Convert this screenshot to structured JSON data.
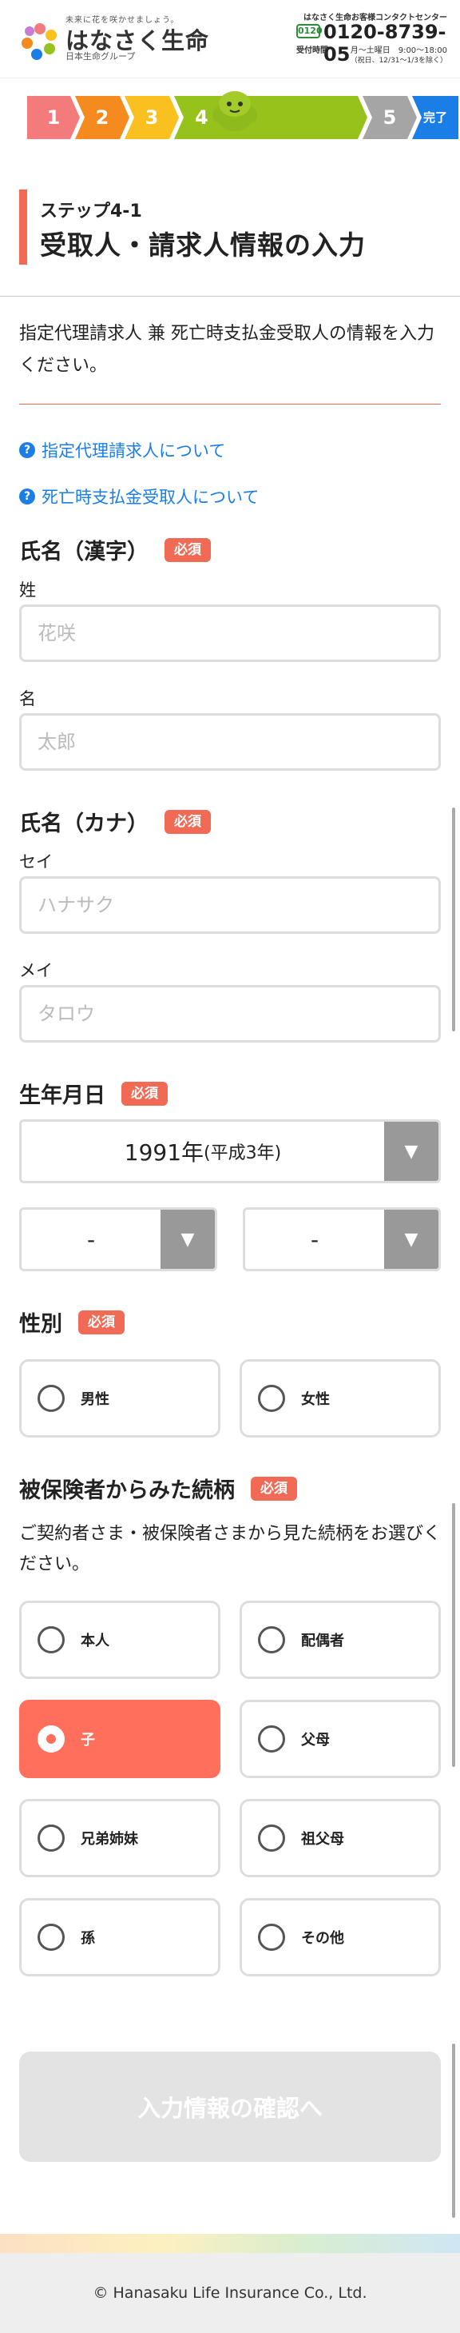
{
  "header": {
    "tagline": "未来に花を咲かせましょう。",
    "company_name": "はなさく生命",
    "group": "日本生命グループ",
    "contact_title": "はなさく生命お客様コンタクトセンター",
    "freedial_label": "0120",
    "phone": "0120-8739-05",
    "hours_label": "受付時間",
    "hours": "月〜土曜日　9:00〜18:00",
    "holiday_note": "（祝日、12/31〜1/3を除く）"
  },
  "progress": {
    "steps": [
      "1",
      "2",
      "3",
      "4",
      "5",
      "完了"
    ],
    "current": 4,
    "colors": {
      "step1": "#f47b7b",
      "step2": "#f58a1f",
      "step3": "#f9c020",
      "step4": "#97c21c",
      "step5": "#a5a5a5",
      "complete": "#1a7ee6"
    }
  },
  "page": {
    "step_label": "ステップ4-1",
    "title": "受取人・請求人情報の入力",
    "intro": "指定代理請求人 兼 死亡時支払金受取人の情報を入力ください。"
  },
  "help_links": [
    {
      "label": "指定代理請求人について",
      "icon": "question-circle-icon"
    },
    {
      "label": "死亡時支払金受取人について",
      "icon": "question-circle-icon"
    }
  ],
  "required_badge": "必須",
  "name_kanji": {
    "label": "氏名（漢字）",
    "surname_label": "姓",
    "surname_placeholder": "花咲",
    "given_label": "名",
    "given_placeholder": "太郎"
  },
  "name_kana": {
    "label": "氏名（カナ）",
    "surname_label": "セイ",
    "surname_placeholder": "ハナサク",
    "given_label": "メイ",
    "given_placeholder": "タロウ"
  },
  "birthdate": {
    "label": "生年月日",
    "year_value": "1991年",
    "year_era": "(平成3年)",
    "month_value": "-",
    "day_value": "-"
  },
  "gender": {
    "label": "性別",
    "options": [
      "男性",
      "女性"
    ]
  },
  "relationship": {
    "label": "被保険者からみた続柄",
    "note": "ご契約者さま・被保険者さまから見た続柄をお選びください。",
    "options": [
      "本人",
      "配偶者",
      "子",
      "父母",
      "兄弟姉妹",
      "祖父母",
      "孫",
      "その他"
    ],
    "selected": "子"
  },
  "confirm_button": "入力情報の確認へ",
  "footer": "© Hanasaku Life Insurance Co., Ltd."
}
